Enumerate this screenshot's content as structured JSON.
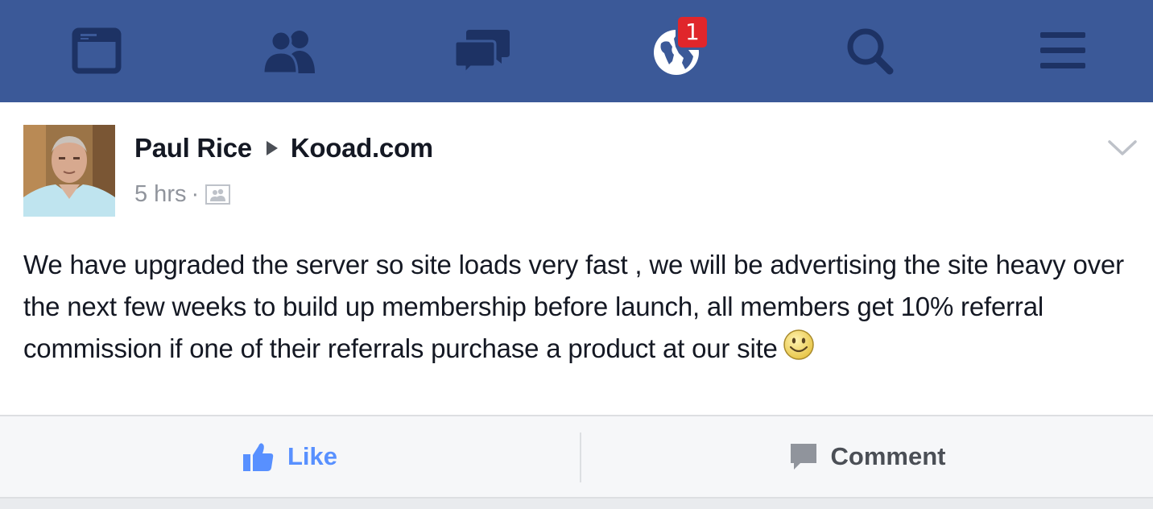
{
  "nav": {
    "items": [
      {
        "name": "news-feed",
        "icon": "news-feed-icon"
      },
      {
        "name": "friend-requests",
        "icon": "friends-icon"
      },
      {
        "name": "messages",
        "icon": "chat-bubbles-icon"
      },
      {
        "name": "notifications",
        "icon": "globe-icon",
        "badge": "1"
      },
      {
        "name": "search",
        "icon": "search-icon"
      },
      {
        "name": "more",
        "icon": "menu-icon"
      }
    ],
    "bar_color": "#3b5998",
    "icon_color": "#1d3264",
    "badge_color": "#e0262b"
  },
  "post": {
    "author": "Paul Rice",
    "target": "Kooad.com",
    "time": "5 hrs",
    "separator": "·",
    "audience_icon": "friends-audience-icon",
    "body": "We have upgraded the server so site loads very fast , we will be advertising the site heavy over the next few weeks to build up membership before launch, all members get 10% referral commission if one of their referrals purchase a product at our site",
    "emoji": "smiley-icon"
  },
  "actions": {
    "like_label": "Like",
    "comment_label": "Comment",
    "like_color": "#5890ff"
  }
}
